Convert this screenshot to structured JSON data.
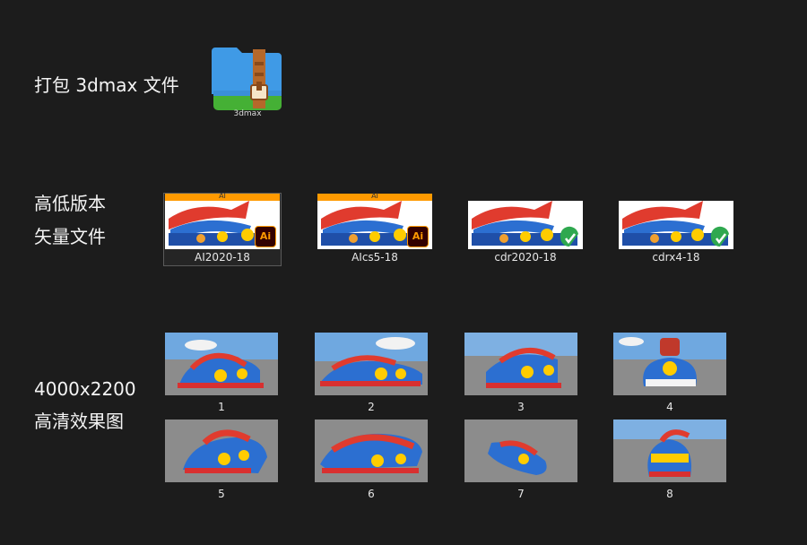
{
  "labels": {
    "package": "打包 3dmax 文件",
    "vector_line1": "高低版本",
    "vector_line2": "矢量文件",
    "render_line1": "4000x2200",
    "render_line2": "高清效果图"
  },
  "archive": {
    "icon": "zip-folder-icon",
    "name": "3dmax"
  },
  "vector_files": [
    {
      "name": "AI2020-18",
      "badge_icon": "illustrator-icon",
      "badge_text": "Ai",
      "header": "AI",
      "selected": true
    },
    {
      "name": "AIcs5-18",
      "badge_icon": "illustrator-icon",
      "badge_text": "Ai",
      "header": "AI",
      "selected": false
    },
    {
      "name": "cdr2020-18",
      "badge_icon": "coreldraw-icon",
      "selected": false
    },
    {
      "name": "cdrx4-18",
      "badge_icon": "coreldraw-icon",
      "selected": false
    }
  ],
  "renders": [
    "1",
    "2",
    "3",
    "4",
    "5",
    "6",
    "7",
    "8"
  ],
  "colors": {
    "background": "#1c1c1c",
    "ai_badge": "#ff9a00",
    "ai_badge_bg": "#330000",
    "cdr_badge": "#2fa84f",
    "zip_blue": "#3f9ae6",
    "zip_green": "#45b035",
    "zip_strap": "#b5682a"
  }
}
